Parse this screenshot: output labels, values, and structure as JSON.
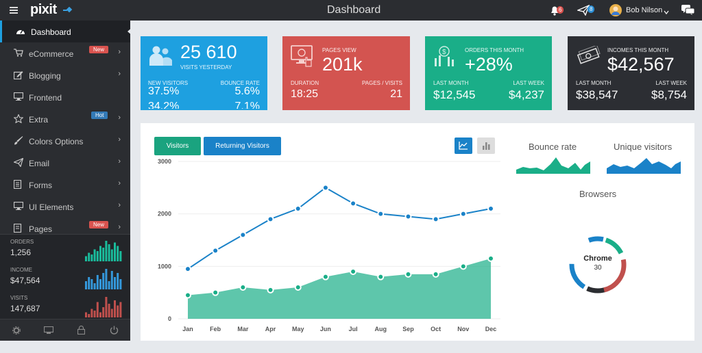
{
  "topbar": {
    "logo": "pixit",
    "title": "Dashboard",
    "notif_count": "6",
    "send_count": "8",
    "user_name": "Bob Nilson"
  },
  "sidebar": {
    "items": [
      {
        "label": "Dashboard",
        "icon": "dashboard-icon",
        "active": true
      },
      {
        "label": "eCommerce",
        "icon": "cart-icon",
        "badge": "New",
        "badge_color": "#d9534f"
      },
      {
        "label": "Blogging",
        "icon": "edit-icon"
      },
      {
        "label": "Frontend",
        "icon": "monitor-icon"
      },
      {
        "label": "Extra",
        "icon": "star-icon",
        "badge": "Hot",
        "badge_color": "#337ab7"
      },
      {
        "label": "Colors Options",
        "icon": "brush-icon"
      },
      {
        "label": "Email",
        "icon": "send-icon"
      },
      {
        "label": "Forms",
        "icon": "form-icon"
      },
      {
        "label": "UI Elements",
        "icon": "laptop-icon"
      },
      {
        "label": "Pages",
        "icon": "pages-icon",
        "badge": "New",
        "badge_color": "#d9534f"
      }
    ],
    "stats": [
      {
        "label": "ORDERS",
        "value": "1,256",
        "color": "#1abc9c",
        "bars": [
          3,
          5,
          4,
          7,
          6,
          9,
          8,
          12,
          10,
          7,
          11,
          9,
          6
        ]
      },
      {
        "label": "INCOME",
        "value": "$47,564",
        "color": "#3498db",
        "bars": [
          4,
          6,
          5,
          3,
          7,
          5,
          8,
          10,
          4,
          9,
          6,
          8,
          5
        ]
      },
      {
        "label": "VISITS",
        "value": "147,687",
        "color": "#c0504d",
        "bars": [
          3,
          2,
          5,
          4,
          9,
          3,
          6,
          12,
          8,
          5,
          10,
          7,
          9
        ]
      }
    ],
    "footer_icons": [
      "gear-icon",
      "monitor-icon",
      "lock-icon",
      "power-icon"
    ]
  },
  "tiles": [
    {
      "color": "#1ea0e0",
      "big": "25 610",
      "sub": "VISITS YESTERDAY",
      "left_label": "NEW VISITORS",
      "right_label": "BOUNCE RATE",
      "left_value": "37.5%",
      "right_value": "5.6%",
      "left_value2": "34.2%",
      "right_value2": "7.1%",
      "icon": "users-icon"
    },
    {
      "color": "#d35450",
      "title": "PAGES VIEW",
      "big": "201k",
      "left_label": "DURATION",
      "right_label": "PAGES / VISITS",
      "left_value": "18:25",
      "right_value": "21",
      "icon": "monitor-touch-icon"
    },
    {
      "color": "#1aae88",
      "title": "ORDERS THIS MONTH",
      "big": "+28%",
      "left_label": "LAST MONTH",
      "right_label": "LAST WEEK",
      "left_value": "$12,545",
      "right_value": "$4,237",
      "icon": "chart-dollar-icon"
    },
    {
      "color": "#2c2e33",
      "title": "INCOMES THIS MONTH",
      "big": "$42,567",
      "left_label": "LAST MONTH",
      "right_label": "LAST WEEK",
      "left_value": "$38,547",
      "right_value": "$8,754",
      "icon": "money-icon"
    }
  ],
  "chart_panel": {
    "btn_visitors": "Visitors",
    "btn_returning": "Returning Visitors",
    "bounce_rate": "Bounce rate",
    "unique_visitors": "Unique visitors",
    "browsers": "Browsers",
    "donut_label": "Chrome",
    "donut_value": "30"
  },
  "chart_data": {
    "type": "line",
    "categories": [
      "Jan",
      "Feb",
      "Mar",
      "Apr",
      "May",
      "Jun",
      "Jul",
      "Aug",
      "Sep",
      "Oct",
      "Nov",
      "Dec"
    ],
    "ylim": [
      0,
      3000
    ],
    "yticks": [
      0,
      1000,
      2000,
      3000
    ],
    "series": [
      {
        "name": "",
        "color": "#1a82c8",
        "values": [
          950,
          1300,
          1600,
          1900,
          2100,
          2500,
          2200,
          2000,
          1950,
          1900,
          2000,
          2100
        ]
      },
      {
        "name": "",
        "color": "#1aae88",
        "values": [
          450,
          500,
          600,
          550,
          600,
          800,
          900,
          800,
          850,
          850,
          1000,
          1150
        ]
      }
    ]
  }
}
